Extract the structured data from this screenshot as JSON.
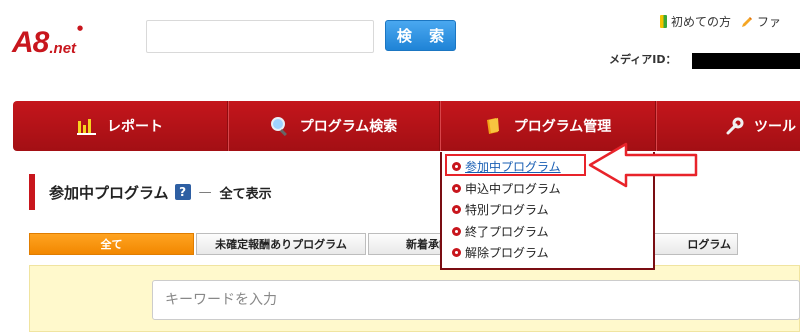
{
  "header": {
    "logo": "A8.net",
    "search_placeholder": "",
    "search_button": "検 索",
    "links": [
      "初めての方",
      "ファ"
    ],
    "media_id_label": "メディアID："
  },
  "nav": {
    "items": [
      {
        "label": "レポート",
        "icon": "bar-chart-icon"
      },
      {
        "label": "プログラム検索",
        "icon": "magnifier-icon"
      },
      {
        "label": "プログラム管理",
        "icon": "folder-icon"
      },
      {
        "label": "ツール",
        "icon": "wrench-icon"
      }
    ]
  },
  "page": {
    "title": "参加中プログラム",
    "help": "?",
    "dash": "—",
    "subtitle": "全て表示"
  },
  "tabs": [
    "全て",
    "未確定報酬ありプログラム",
    "新着承認",
    "ログラム"
  ],
  "dropdown": {
    "items": [
      "参加中プログラム",
      "申込中プログラム",
      "特別プログラム",
      "終了プログラム",
      "解除プログラム"
    ],
    "current_index": 0
  },
  "filter": {
    "keyword_placeholder": "キーワードを入力"
  },
  "colors": {
    "brand_red": "#c8161d",
    "nav_red": "#b3121a",
    "search_blue": "#1f83d6",
    "tab_active": "#f28800",
    "panel_yellow": "#fff9cc",
    "link_blue": "#1a5fb4"
  }
}
